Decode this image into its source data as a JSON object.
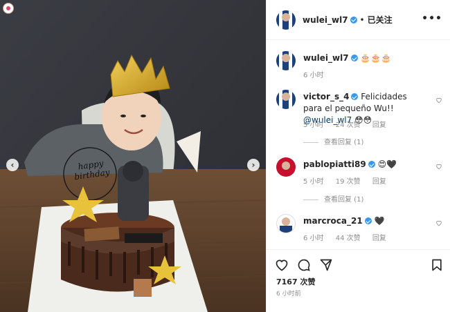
{
  "photo": {
    "banner_text": "happy birthday",
    "crown_color": "#d4a520",
    "background_color": "#3a3a40"
  },
  "post": {
    "username": "wulei_wl7",
    "follow_label": "已关注",
    "separator": "•",
    "more_label": "•••"
  },
  "caption": {
    "username": "wulei_wl7",
    "text": "🎂🎂🎂",
    "time": "6 小时"
  },
  "comments": [
    {
      "username": "victor_s_4",
      "text": "Felicidades para el pequeño Wu!!",
      "mention": "@wulei_wl7",
      "emoji": "😳😳",
      "time": "5 小时",
      "likes": "24 次赞",
      "reply": "回复",
      "view_replies": "查看回复 (1)",
      "avatar_color": "#1d3f7a"
    },
    {
      "username": "pablopiatti89",
      "text": "😍🖤",
      "time": "5 小时",
      "likes": "19 次赞",
      "reply": "回复",
      "view_replies": "查看回复 (1)",
      "avatar_color": "#c8102e"
    },
    {
      "username": "marcroca_21",
      "text": "🖤",
      "time": "6 小时",
      "likes": "44 次赞",
      "reply": "回复",
      "avatar_color": "#1d3f7a"
    }
  ],
  "footer": {
    "likes_count": "7167",
    "likes_label": "次赞",
    "posted_ago": "6 小时前"
  },
  "icons": {
    "like": "heart-icon",
    "comment": "comment-icon",
    "share": "share-icon",
    "save": "bookmark-icon"
  },
  "colors": {
    "verified": "#3897f0",
    "muted": "#8e8e8e",
    "mention": "#00376b"
  }
}
